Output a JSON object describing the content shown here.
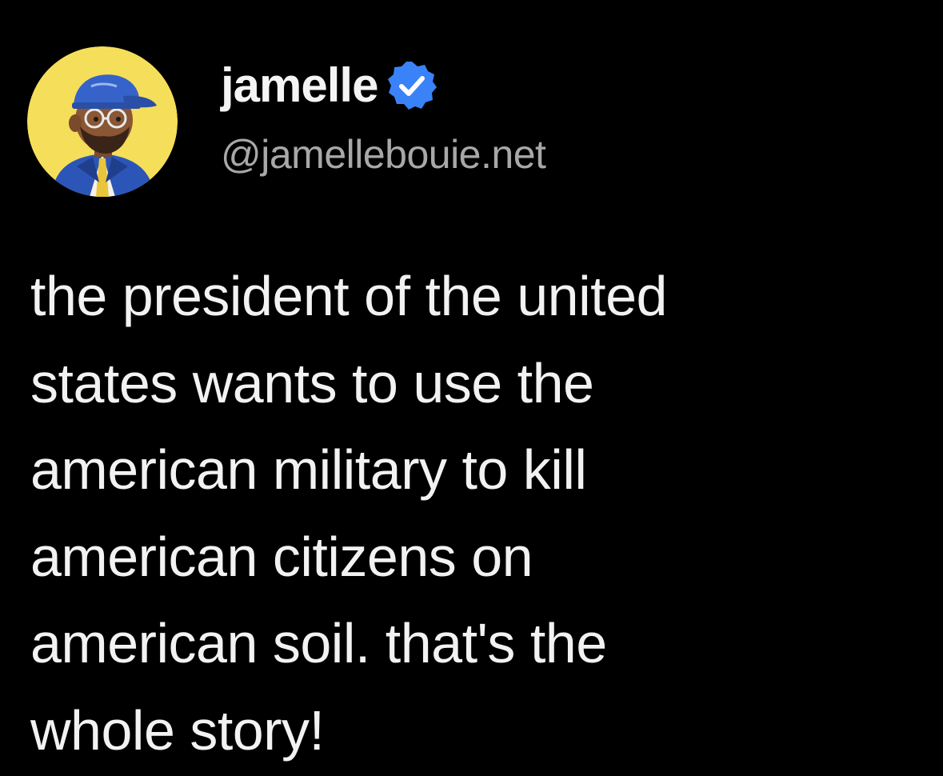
{
  "post": {
    "author": {
      "display_name": "jamelle",
      "handle": "@jamellebouie.net",
      "verified": true,
      "avatar_icon": "cartoon-avatar-icon",
      "verified_icon": "verified-check-icon",
      "avatar_background": "#f5de5a",
      "verified_color": "#3a82f7"
    },
    "text": "the president of the united\nstates wants to use the\namerican military to kill\namerican citizens on\namerican soil. that's the\nwhole story!"
  },
  "theme": {
    "background": "#000000",
    "text_color": "#f2f2f2",
    "handle_color": "#a8a8a8"
  }
}
